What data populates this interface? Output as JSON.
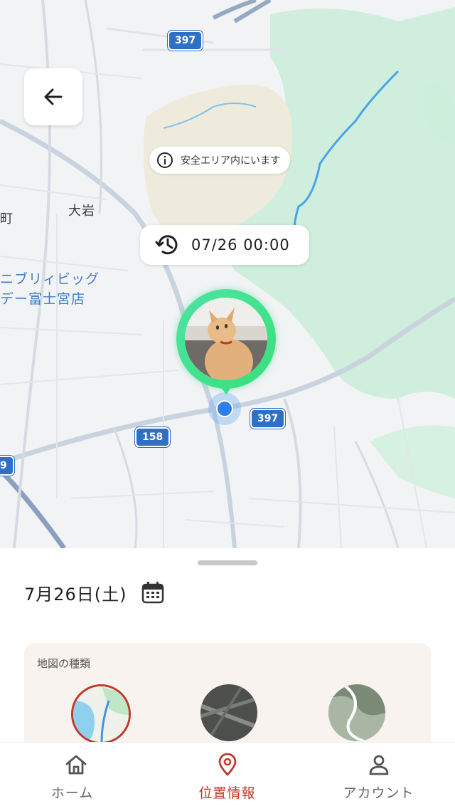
{
  "map": {
    "place_labels": [
      "大岩",
      "町"
    ],
    "poi_lines": [
      "ニブリィビッグ",
      "デー富士宮店"
    ],
    "route_badges": [
      "397",
      "397",
      "158",
      "9"
    ],
    "safe_area_text": "安全エリア内にいます",
    "timestamp": "07/26 00:00",
    "back_icon": "arrow-left-icon",
    "info_icon": "info-circle-icon",
    "history_icon": "clock-history-icon",
    "pet_marker_color": "#3ee08a",
    "location_dot_color": "#2f7ef0"
  },
  "sheet": {
    "date": "7月26日(土)",
    "calendar_icon": "calendar-icon",
    "map_type_title": "地図の種類",
    "selected_ring_color": "#c0392b"
  },
  "nav": {
    "items": [
      {
        "label": "ホーム",
        "icon": "home-icon"
      },
      {
        "label": "位置情報",
        "icon": "location-pin-icon"
      },
      {
        "label": "アカウント",
        "icon": "person-icon"
      }
    ],
    "active_color": "#c0392b"
  }
}
